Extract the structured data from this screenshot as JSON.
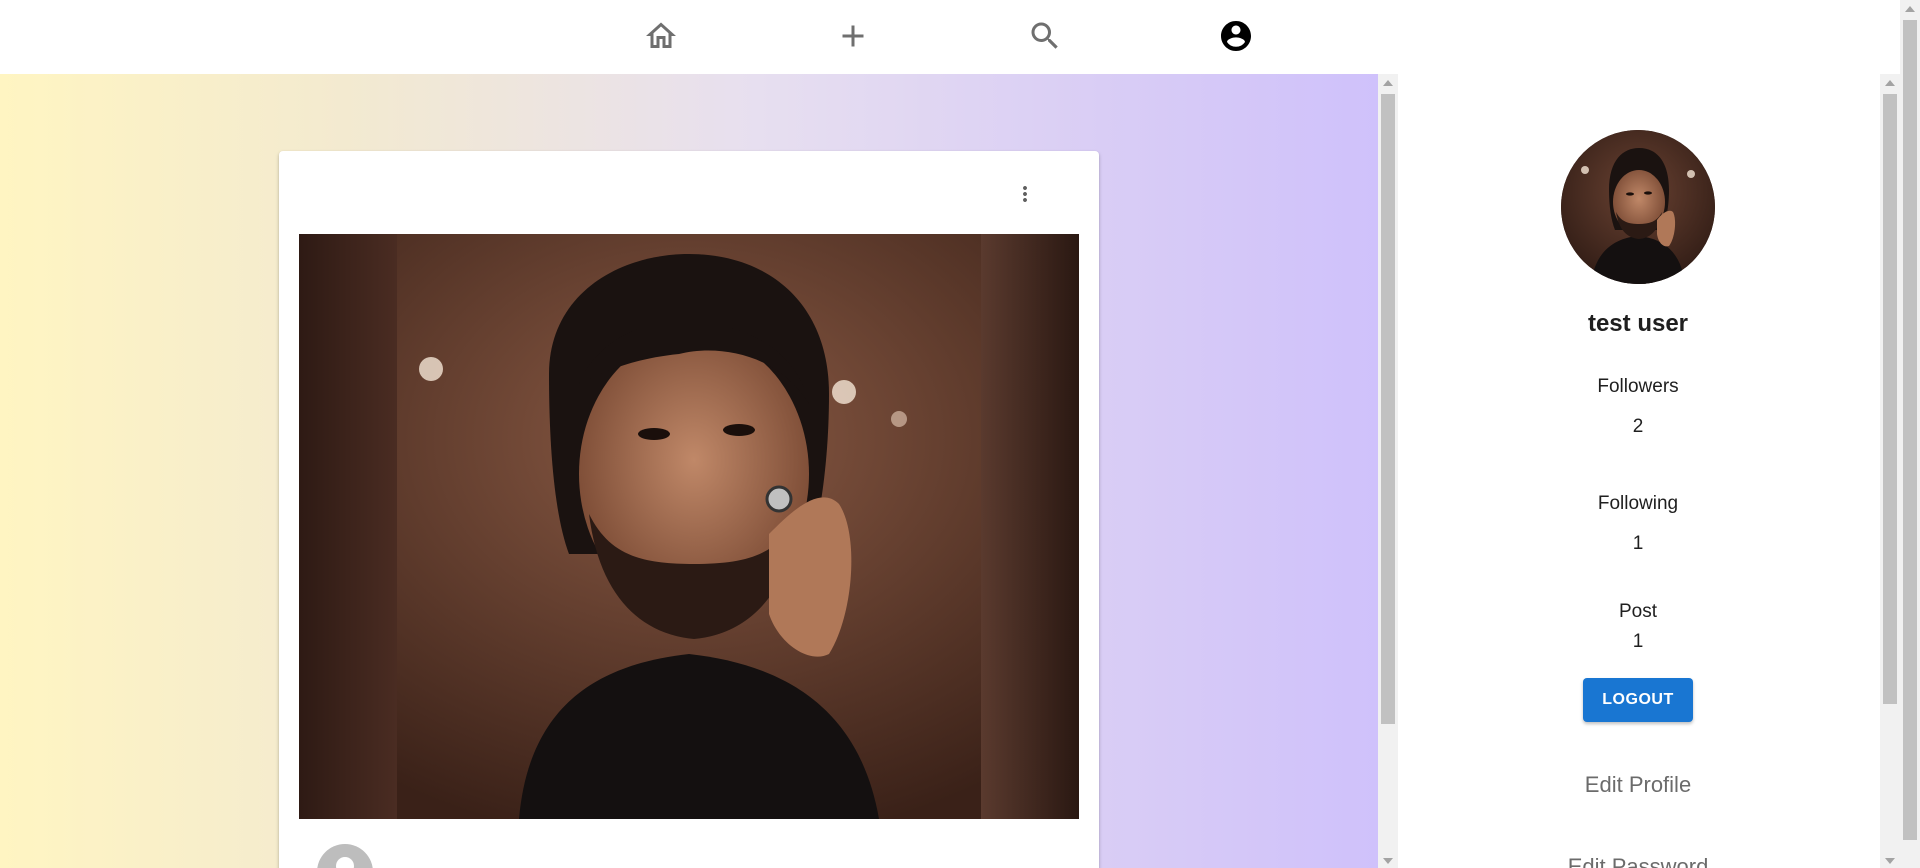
{
  "nav": {
    "items": [
      {
        "icon": "home-icon"
      },
      {
        "icon": "add-icon"
      },
      {
        "icon": "search-icon"
      },
      {
        "icon": "account-circle-icon",
        "active": true
      }
    ]
  },
  "post": {
    "menu_icon": "more-vert-icon",
    "image": "post-photo"
  },
  "profile": {
    "username": "test user",
    "followers_label": "Followers",
    "followers_count": "2",
    "following_label": "Following",
    "following_count": "1",
    "post_label": "Post",
    "post_count": "1",
    "logout_label": "LOGOUT",
    "edit_profile_label": "Edit Profile",
    "edit_password_label": "Edit Password"
  },
  "colors": {
    "primary": "#1976d2",
    "gradient_start": "#fff5c2",
    "gradient_end": "#cfc1fb"
  }
}
